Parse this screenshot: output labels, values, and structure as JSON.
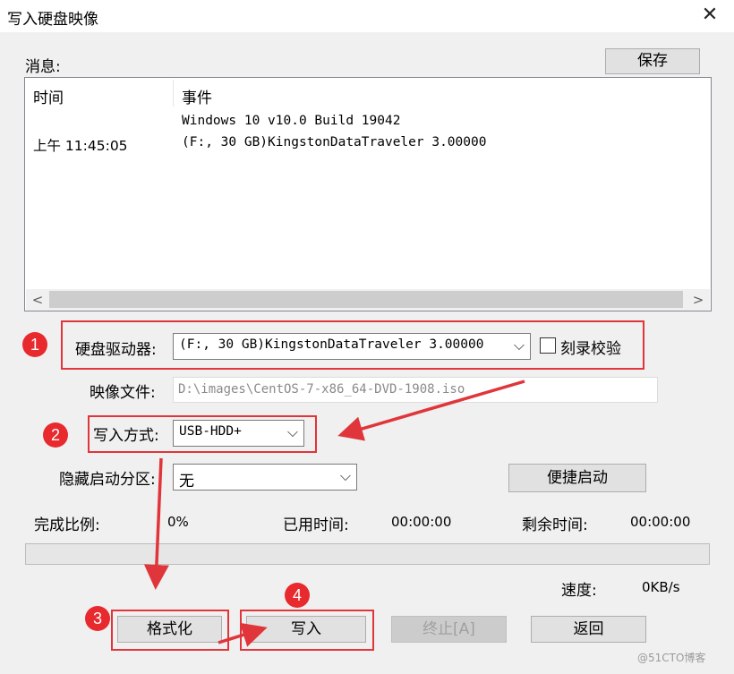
{
  "window": {
    "title": "写入硬盘映像",
    "close_glyph": "✕"
  },
  "messages": {
    "label": "消息:",
    "save_button": "保存",
    "columns": {
      "time": "时间",
      "event": "事件"
    },
    "rows": [
      {
        "time": "",
        "event": "Windows 10 v10.0 Build 19042"
      },
      {
        "time": "上午 11:45:05",
        "event": "(F:, 30 GB)KingstonDataTraveler 3.00000"
      }
    ],
    "scroll_left": "<",
    "scroll_right": ">"
  },
  "drive": {
    "label": "硬盘驱动器:",
    "value": "(F:, 30 GB)KingstonDataTraveler 3.00000",
    "verify_label": "刻录校验",
    "verify_checked": false
  },
  "image_file": {
    "label": "映像文件:",
    "value": "D:\\images\\CentOS-7-x86_64-DVD-1908.iso"
  },
  "write_mode": {
    "label": "写入方式:",
    "value": "USB-HDD+"
  },
  "hidden_partition": {
    "label": "隐藏启动分区:",
    "value": "无"
  },
  "quick_boot_button": "便捷启动",
  "status": {
    "percent_label": "完成比例:",
    "percent_value": "0%",
    "elapsed_label": "已用时间:",
    "elapsed_value": "00:00:00",
    "remaining_label": "剩余时间:",
    "remaining_value": "00:00:00",
    "progress": 0,
    "speed_label": "速度:",
    "speed_value": "0KB/s"
  },
  "buttons": {
    "format": "格式化",
    "write": "写入",
    "stop": "终止[A]",
    "back": "返回"
  },
  "annotations": {
    "badges": [
      "1",
      "2",
      "3",
      "4"
    ],
    "color": "#e0353a"
  },
  "dropdown_glyph": "⌵",
  "watermark": "@51CTO博客"
}
